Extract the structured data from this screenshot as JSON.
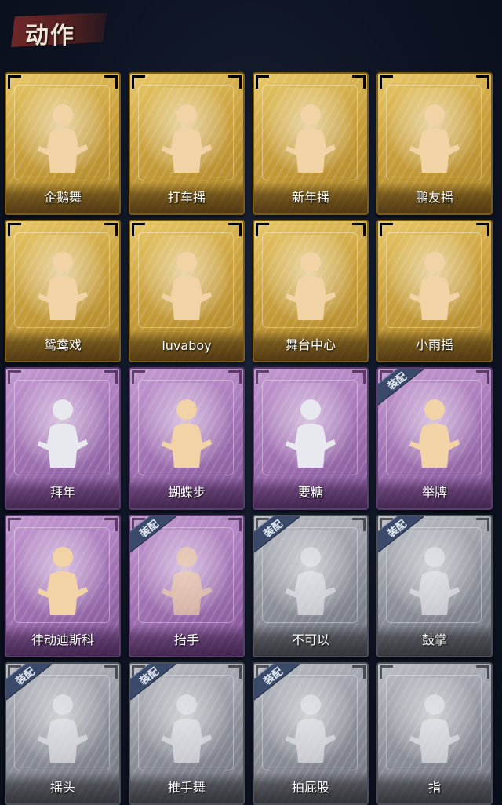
{
  "header": {
    "title": "动作"
  },
  "badge_text": "装配",
  "colors": {
    "gold": "#c9a03c",
    "purple": "#a273b4",
    "gray": "#8e929b",
    "figure_gold": "#f2d3a6",
    "figure_pale": "#e8e9ee"
  },
  "cards": [
    {
      "label": "企鹅舞",
      "tier": "gold",
      "equipped": false,
      "icon": "penguin-dance-pose-icon"
    },
    {
      "label": "打车摇",
      "tier": "gold",
      "equipped": false,
      "icon": "taxi-shake-pose-icon"
    },
    {
      "label": "新年摇",
      "tier": "gold",
      "equipped": false,
      "icon": "new-year-shake-pose-icon"
    },
    {
      "label": "鹏友摇",
      "tier": "gold",
      "equipped": false,
      "icon": "friend-shake-pose-icon"
    },
    {
      "label": "鸳鸯戏",
      "tier": "gold",
      "equipped": false,
      "icon": "mandarin-duck-pose-icon"
    },
    {
      "label": "luvaboy",
      "tier": "gold",
      "equipped": false,
      "icon": "luvaboy-pose-icon"
    },
    {
      "label": "舞台中心",
      "tier": "gold",
      "equipped": false,
      "icon": "center-stage-pose-icon"
    },
    {
      "label": "小雨摇",
      "tier": "gold",
      "equipped": false,
      "icon": "light-rain-pose-icon"
    },
    {
      "label": "拜年",
      "tier": "purple",
      "equipped": false,
      "icon": "new-year-greeting-pose-icon"
    },
    {
      "label": "蝴蝶步",
      "tier": "purple",
      "equipped": false,
      "icon": "butterfly-step-pose-icon"
    },
    {
      "label": "要糖",
      "tier": "purple",
      "equipped": false,
      "icon": "ask-candy-pose-icon"
    },
    {
      "label": "举牌",
      "tier": "purple",
      "equipped": true,
      "icon": "hold-sign-pose-icon"
    },
    {
      "label": "律动迪斯科",
      "tier": "purple",
      "equipped": false,
      "icon": "disco-pose-icon"
    },
    {
      "label": "抬手",
      "tier": "purple",
      "equipped": true,
      "icon": "raise-hand-pose-icon"
    },
    {
      "label": "不可以",
      "tier": "gray",
      "equipped": true,
      "icon": "no-finger-pose-icon"
    },
    {
      "label": "鼓掌",
      "tier": "gray",
      "equipped": true,
      "icon": "clap-pose-icon"
    },
    {
      "label": "摇头",
      "tier": "gray",
      "equipped": true,
      "icon": "head-shake-pose-icon"
    },
    {
      "label": "推手舞",
      "tier": "gray",
      "equipped": true,
      "icon": "push-hand-dance-pose-icon"
    },
    {
      "label": "拍屁股",
      "tier": "gray",
      "equipped": true,
      "icon": "pat-butt-pose-icon"
    },
    {
      "label": "指",
      "tier": "gray",
      "equipped": false,
      "icon": "point-pose-icon"
    }
  ]
}
